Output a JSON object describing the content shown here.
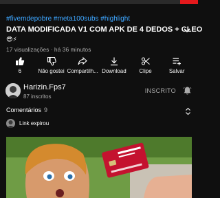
{
  "status_bar": {
    "accent_color": "#e4191c"
  },
  "video": {
    "hashtags": "#fivemdepobre #meta100subs #highlight",
    "title": "DATA MODIFICADA V1 COM APK DE 4 DEDOS + CLEO",
    "emoji_line": "😎⚡",
    "meta": "17 visualizações · há 36 minutos"
  },
  "actions": {
    "like": {
      "label": "6",
      "icon": "thumbs-up-filled-icon"
    },
    "dislike": {
      "label": "Não gostei",
      "icon": "thumbs-down-icon"
    },
    "share": {
      "label": "Compartilh...",
      "icon": "share-icon"
    },
    "download": {
      "label": "Download",
      "icon": "download-icon"
    },
    "clip": {
      "label": "Clipe",
      "icon": "scissors-icon"
    },
    "save": {
      "label": "Salvar",
      "icon": "save-playlist-icon"
    }
  },
  "channel": {
    "name": "Harizin.Fps7",
    "subscribers": "87 inscritos",
    "subscribe_state": "INSCRITO"
  },
  "comments": {
    "heading": "Comentários",
    "count": "9",
    "first_comment": "Link expirou"
  },
  "colors": {
    "background": "#0f0f0f",
    "link_blue": "#3ea6ff",
    "secondary_text": "#aaaaaa"
  }
}
